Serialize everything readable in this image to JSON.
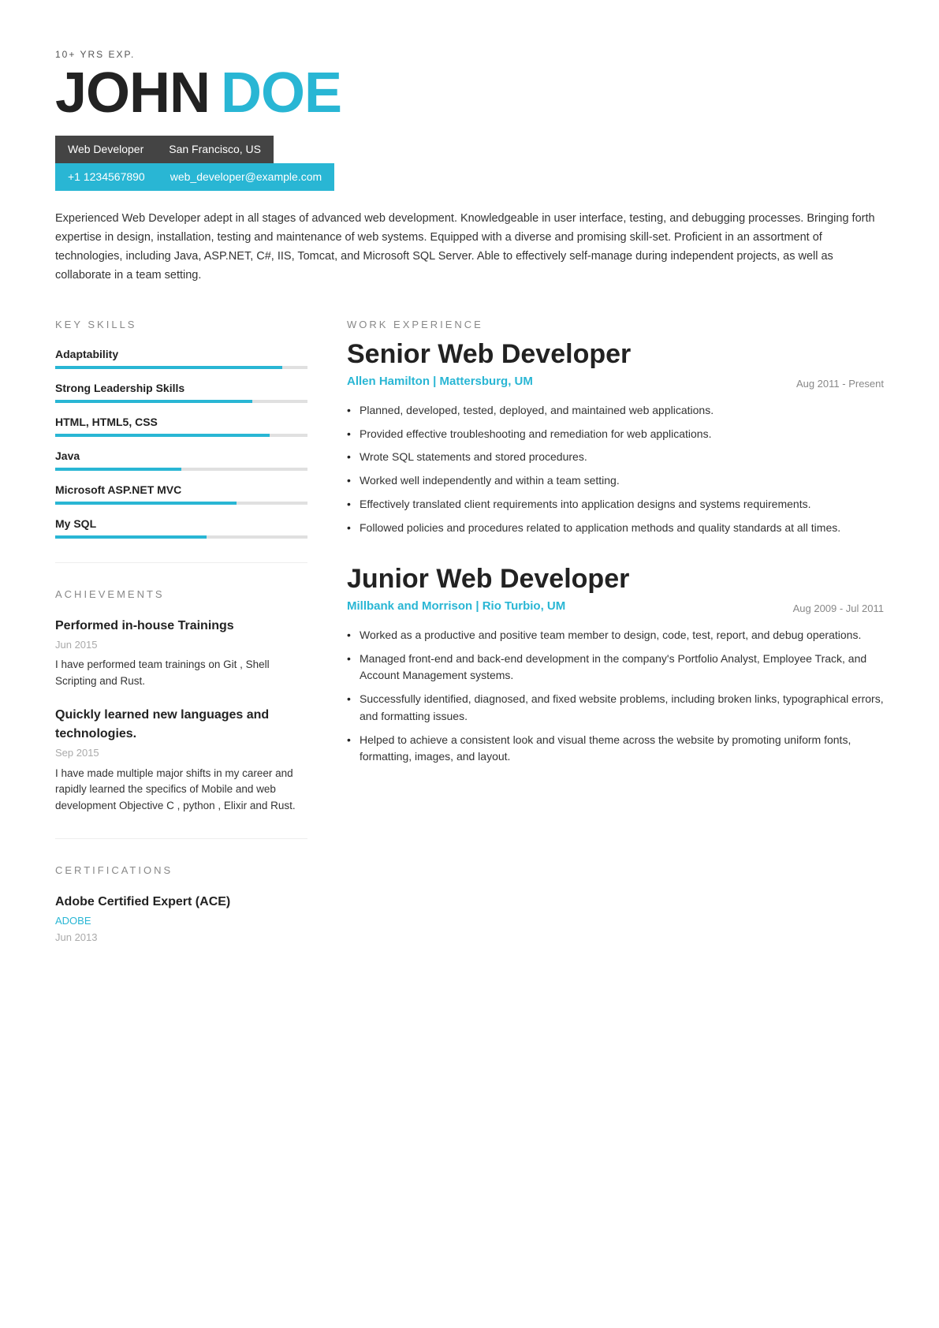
{
  "header": {
    "exp_label": "10+ YRS EXP.",
    "first_name": "JOHN",
    "last_name": "DOE",
    "title": "Web Developer",
    "location": "San Francisco, US",
    "phone": "+1 1234567890",
    "email": "web_developer@example.com"
  },
  "summary": "Experienced Web Developer adept in all stages of advanced web development. Knowledgeable in user interface, testing, and debugging processes. Bringing forth expertise in design, installation, testing and maintenance of web systems. Equipped with a diverse and promising skill-set. Proficient in an assortment of technologies, including Java, ASP.NET, C#, IIS, Tomcat, and Microsoft SQL Server. Able to effectively self-manage during independent projects, as well as collaborate in a team setting.",
  "sections": {
    "key_skills": "KEY SKILLS",
    "achievements": "ACHIEVEMENTS",
    "certifications": "CERTIFICATIONS",
    "work_experience": "WORK EXPERIENCE"
  },
  "skills": [
    {
      "name": "Adaptability",
      "pct": 90
    },
    {
      "name": "Strong Leadership Skills",
      "pct": 78
    },
    {
      "name": "HTML, HTML5, CSS",
      "pct": 85
    },
    {
      "name": "Java",
      "pct": 50
    },
    {
      "name": "Microsoft ASP.NET MVC",
      "pct": 72
    },
    {
      "name": "My SQL",
      "pct": 60
    }
  ],
  "achievements": [
    {
      "title": "Performed in-house Trainings",
      "date": "Jun 2015",
      "desc": "I have performed team trainings on Git , Shell Scripting and Rust."
    },
    {
      "title": "Quickly learned new languages and technologies.",
      "date": "Sep 2015",
      "desc": "I have made multiple major shifts in my career and rapidly learned the specifics of Mobile and web development Objective C , python , Elixir and Rust."
    }
  ],
  "certifications": [
    {
      "title": "Adobe Certified Expert (ACE)",
      "org": "ADOBE",
      "date": "Jun 2013"
    }
  ],
  "work_experience": [
    {
      "title": "Senior Web Developer",
      "company": "Allen Hamilton | Mattersburg, UM",
      "date": "Aug 2011 - Present",
      "bullets": [
        "Planned, developed, tested, deployed, and maintained web applications.",
        "Provided effective troubleshooting and remediation for web applications.",
        "Wrote SQL statements and stored procedures.",
        "Worked well independently and within a team setting.",
        "Effectively translated client requirements into application designs and systems requirements.",
        "Followed policies and procedures related to application methods and quality standards at all times."
      ]
    },
    {
      "title": "Junior Web Developer",
      "company": "Millbank and Morrison | Rio Turbio, UM",
      "date": "Aug 2009 - Jul 2011",
      "bullets": [
        "Worked as a productive and positive team member to design, code, test, report, and debug operations.",
        "Managed front-end and back-end development in the company's Portfolio Analyst, Employee Track, and Account Management systems.",
        "Successfully identified, diagnosed, and fixed website problems, including broken links, typographical errors, and formatting issues.",
        "Helped to achieve a consistent look and visual theme across the website by promoting uniform fonts, formatting, images, and layout."
      ]
    }
  ]
}
